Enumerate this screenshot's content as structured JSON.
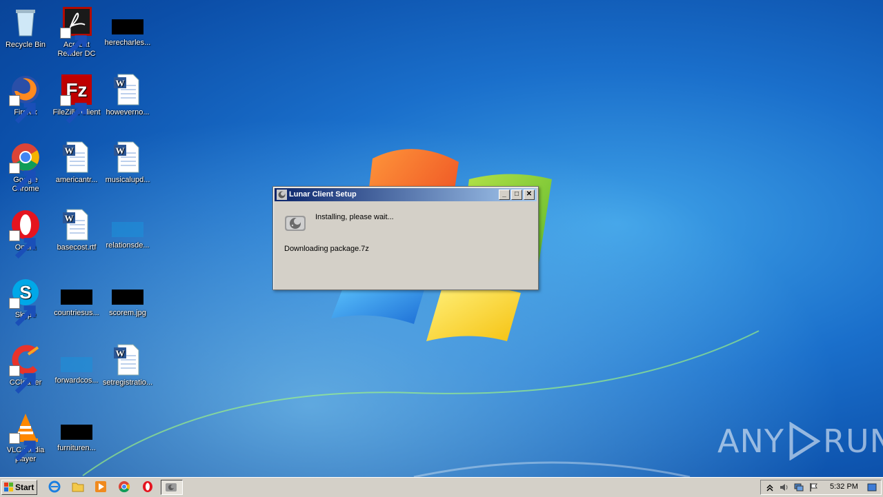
{
  "desktop": {
    "icons": [
      {
        "label": "Recycle Bin"
      },
      {
        "label": "Acrobat Reader DC"
      },
      {
        "label": "herecharles..."
      },
      {
        "label": "Firefox"
      },
      {
        "label": "FileZilla Client"
      },
      {
        "label": "howeverno..."
      },
      {
        "label": "Google Chrome"
      },
      {
        "label": "americantr..."
      },
      {
        "label": "musicalupd..."
      },
      {
        "label": "Opera"
      },
      {
        "label": "basecost.rtf"
      },
      {
        "label": "relationsde..."
      },
      {
        "label": "Skype"
      },
      {
        "label": "countriesus..."
      },
      {
        "label": "scorem.jpg"
      },
      {
        "label": "CCleaner"
      },
      {
        "label": "forwardcos..."
      },
      {
        "label": "setregistratio..."
      },
      {
        "label": "VLC media player"
      },
      {
        "label": "furnituren..."
      }
    ]
  },
  "dialog": {
    "title": "Lunar Client Setup",
    "minimize": "_",
    "maximize": "□",
    "close": "✕",
    "status": "Installing, please wait...",
    "detail": "Downloading package.7z"
  },
  "taskbar": {
    "start_label": "Start",
    "clock": "5:32 PM"
  },
  "watermark": {
    "left": "ANY",
    "right": "RUN"
  },
  "colors": {
    "accent": "#0a246a",
    "desktop": "#1a6fcb"
  }
}
